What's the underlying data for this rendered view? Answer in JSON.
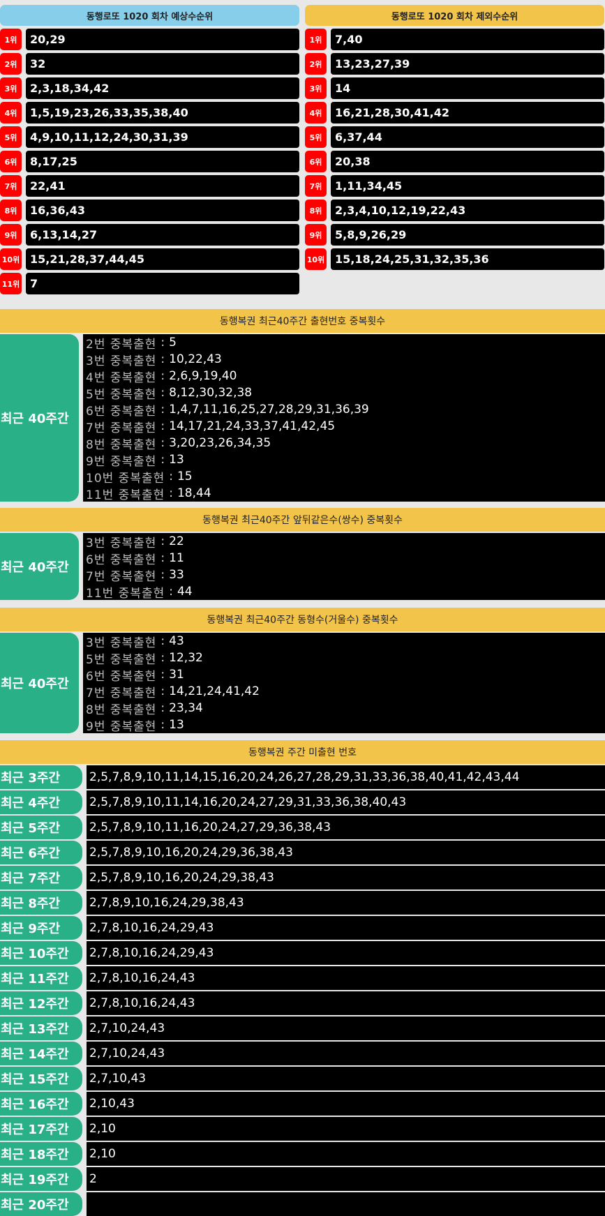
{
  "predicted": {
    "header": "동행로또 1020 회차 예상수순위",
    "rows": [
      {
        "rank": "1위",
        "nums": "20,29"
      },
      {
        "rank": "2위",
        "nums": "32"
      },
      {
        "rank": "3위",
        "nums": "2,3,18,34,42"
      },
      {
        "rank": "4위",
        "nums": "1,5,19,23,26,33,35,38,40"
      },
      {
        "rank": "5위",
        "nums": "4,9,10,11,12,24,30,31,39"
      },
      {
        "rank": "6위",
        "nums": "8,17,25"
      },
      {
        "rank": "7위",
        "nums": "22,41"
      },
      {
        "rank": "8위",
        "nums": "16,36,43"
      },
      {
        "rank": "9위",
        "nums": "6,13,14,27"
      },
      {
        "rank": "10위",
        "nums": "15,21,28,37,44,45"
      },
      {
        "rank": "11위",
        "nums": "7"
      }
    ]
  },
  "excluded": {
    "header": "동행로또 1020 회차 제외수순위",
    "rows": [
      {
        "rank": "1위",
        "nums": "7,40"
      },
      {
        "rank": "2위",
        "nums": "13,23,27,39"
      },
      {
        "rank": "3위",
        "nums": "14"
      },
      {
        "rank": "4위",
        "nums": "16,21,28,30,41,42"
      },
      {
        "rank": "5위",
        "nums": "6,37,44"
      },
      {
        "rank": "6위",
        "nums": "20,38"
      },
      {
        "rank": "7위",
        "nums": "1,11,34,45"
      },
      {
        "rank": "8위",
        "nums": "2,3,4,10,12,19,22,43"
      },
      {
        "rank": "9위",
        "nums": "5,8,9,26,29"
      },
      {
        "rank": "10위",
        "nums": "15,18,24,25,31,32,35,36"
      }
    ]
  },
  "dup_recent": {
    "header": "동행복권 최근40주간 출현번호 중복횟수",
    "label": "최근 40주간",
    "lines": [
      {
        "label": "2번 중복출현",
        "nums": "5"
      },
      {
        "label": "3번 중복출현",
        "nums": "10,22,43"
      },
      {
        "label": "4번 중복출현",
        "nums": "2,6,9,19,40"
      },
      {
        "label": "5번 중복출현",
        "nums": "8,12,30,32,38"
      },
      {
        "label": "6번 중복출현",
        "nums": "1,4,7,11,16,25,27,28,29,31,36,39"
      },
      {
        "label": "7번 중복출현",
        "nums": "14,17,21,24,33,37,41,42,45"
      },
      {
        "label": "8번 중복출현",
        "nums": "3,20,23,26,34,35"
      },
      {
        "label": "9번 중복출현",
        "nums": "13"
      },
      {
        "label": "10번 중복출현",
        "nums": "15"
      },
      {
        "label": "11번 중복출현",
        "nums": "18,44"
      }
    ]
  },
  "dup_same": {
    "header": "동행복권 최근40주간 앞뒤같은수(쌍수) 중복횟수",
    "label": "최근 40주간",
    "lines": [
      {
        "label": "3번 중복출현",
        "nums": "22"
      },
      {
        "label": "6번 중복출현",
        "nums": "11"
      },
      {
        "label": "7번 중복출현",
        "nums": "33"
      },
      {
        "label": "11번 중복출현",
        "nums": "44"
      }
    ]
  },
  "dup_mirror": {
    "header": "동행복권 최근40주간 동형수(거울수) 중복횟수",
    "label": "최근 40주간",
    "lines": [
      {
        "label": "3번 중복출현",
        "nums": "43"
      },
      {
        "label": "5번 중복출현",
        "nums": "12,32"
      },
      {
        "label": "6번 중복출현",
        "nums": "31"
      },
      {
        "label": "7번 중복출현",
        "nums": "14,21,24,41,42"
      },
      {
        "label": "8번 중복출현",
        "nums": "23,34"
      },
      {
        "label": "9번 중복출현",
        "nums": "13"
      }
    ]
  },
  "sep": ":",
  "weekly": {
    "header": "동행복권 주간 미출현 번호",
    "rows": [
      {
        "label": "최근 3주간",
        "nums": "2,5,7,8,9,10,11,14,15,16,20,24,26,27,28,29,31,33,36,38,40,41,42,43,44"
      },
      {
        "label": "최근 4주간",
        "nums": "2,5,7,8,9,10,11,14,16,20,24,27,29,31,33,36,38,40,43"
      },
      {
        "label": "최근 5주간",
        "nums": "2,5,7,8,9,10,11,16,20,24,27,29,36,38,43"
      },
      {
        "label": "최근 6주간",
        "nums": "2,5,7,8,9,10,16,20,24,29,36,38,43"
      },
      {
        "label": "최근 7주간",
        "nums": "2,5,7,8,9,10,16,20,24,29,38,43"
      },
      {
        "label": "최근 8주간",
        "nums": "2,7,8,9,10,16,24,29,38,43"
      },
      {
        "label": "최근 9주간",
        "nums": "2,7,8,10,16,24,29,43"
      },
      {
        "label": "최근 10주간",
        "nums": "2,7,8,10,16,24,29,43"
      },
      {
        "label": "최근 11주간",
        "nums": "2,7,8,10,16,24,43"
      },
      {
        "label": "최근 12주간",
        "nums": "2,7,8,10,16,24,43"
      },
      {
        "label": "최근 13주간",
        "nums": "2,7,10,24,43"
      },
      {
        "label": "최근 14주간",
        "nums": "2,7,10,24,43"
      },
      {
        "label": "최근 15주간",
        "nums": "2,7,10,43"
      },
      {
        "label": "최근 16주간",
        "nums": "2,10,43"
      },
      {
        "label": "최근 17주간",
        "nums": "2,10"
      },
      {
        "label": "최근 18주간",
        "nums": "2,10"
      },
      {
        "label": "최근 19주간",
        "nums": "2"
      },
      {
        "label": "최근 20주간",
        "nums": ""
      }
    ]
  }
}
